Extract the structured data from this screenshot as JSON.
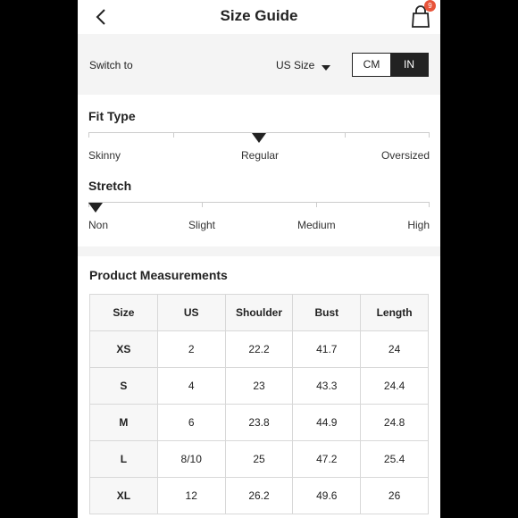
{
  "header": {
    "title": "Size Guide",
    "cart_count": "9"
  },
  "switch": {
    "label": "Switch to",
    "selected_size": "US Size",
    "units": [
      "CM",
      "IN"
    ],
    "active_unit": "IN"
  },
  "fit": {
    "title": "Fit Type",
    "labels": [
      "Skinny",
      "Regular",
      "Oversized"
    ],
    "selected": "Regular"
  },
  "stretch": {
    "title": "Stretch",
    "labels": [
      "Non",
      "Slight",
      "Medium",
      "High"
    ],
    "selected": "Non"
  },
  "measurements": {
    "title": "Product Measurements",
    "headers": [
      "Size",
      "US",
      "Shoulder",
      "Bust",
      "Length"
    ],
    "rows": [
      [
        "XS",
        "2",
        "22.2",
        "41.7",
        "24"
      ],
      [
        "S",
        "4",
        "23",
        "43.3",
        "24.4"
      ],
      [
        "M",
        "6",
        "23.8",
        "44.9",
        "24.8"
      ],
      [
        "L",
        "8/10",
        "25",
        "47.2",
        "25.4"
      ],
      [
        "XL",
        "12",
        "26.2",
        "49.6",
        "26"
      ]
    ]
  }
}
